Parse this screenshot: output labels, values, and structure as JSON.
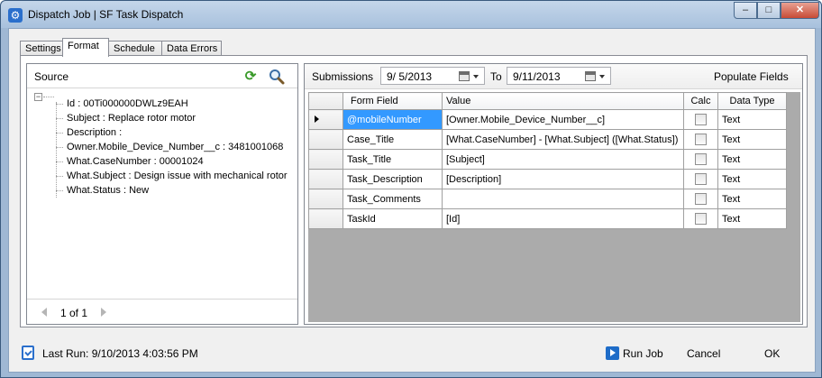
{
  "window": {
    "title": "Dispatch Job | SF Task Dispatch",
    "controls": {
      "minimize": "–",
      "maximize": "□",
      "close": "✕"
    }
  },
  "tabs": [
    {
      "label": "Settings",
      "active": false
    },
    {
      "label": "Format",
      "active": true
    },
    {
      "label": "Schedule",
      "active": false
    },
    {
      "label": "Data Errors",
      "active": false
    }
  ],
  "source": {
    "title": "Source",
    "icons": {
      "refresh": "refresh-icon",
      "search": "search-icon"
    },
    "tree_toggle": "−",
    "items": [
      "Id : 00Ti000000DWLz9EAH",
      "Subject : Replace rotor motor",
      "Description :",
      "Owner.Mobile_Device_Number__c : 3481001068",
      "What.CaseNumber : 00001024",
      "What.Subject : Design issue with mechanical rotor",
      "What.Status : New"
    ],
    "pager": {
      "text": "1 of 1"
    }
  },
  "submissions": {
    "label": "Submissions",
    "from": "9/  5/2013",
    "to_label": "To",
    "to": "9/11/2013",
    "populate_label": "Populate Fields"
  },
  "grid": {
    "columns": [
      "Form Field",
      "Value",
      "Calc",
      "Data Type"
    ],
    "rows": [
      {
        "field": "@mobileNumber",
        "value": "[Owner.Mobile_Device_Number__c]",
        "calc": false,
        "type": "Text",
        "current": true
      },
      {
        "field": "Case_Title",
        "value": "[What.CaseNumber] - [What.Subject] ([What.Status])",
        "calc": false,
        "type": "Text",
        "current": false
      },
      {
        "field": "Task_Title",
        "value": "[Subject]",
        "calc": false,
        "type": "Text",
        "current": false
      },
      {
        "field": "Task_Description",
        "value": "[Description]",
        "calc": false,
        "type": "Text",
        "current": false
      },
      {
        "field": "Task_Comments",
        "value": "",
        "calc": false,
        "type": "Text",
        "current": false
      },
      {
        "field": "TaskId",
        "value": "[Id]",
        "calc": false,
        "type": "Text",
        "current": false
      }
    ]
  },
  "footer": {
    "last_run": "Last Run: 9/10/2013 4:03:56 PM",
    "run_job": "Run Job",
    "cancel": "Cancel",
    "ok": "OK"
  },
  "colors": {
    "selection": "#3399ff",
    "accent": "#2a6fcc",
    "refresh": "#3a9a2a"
  }
}
